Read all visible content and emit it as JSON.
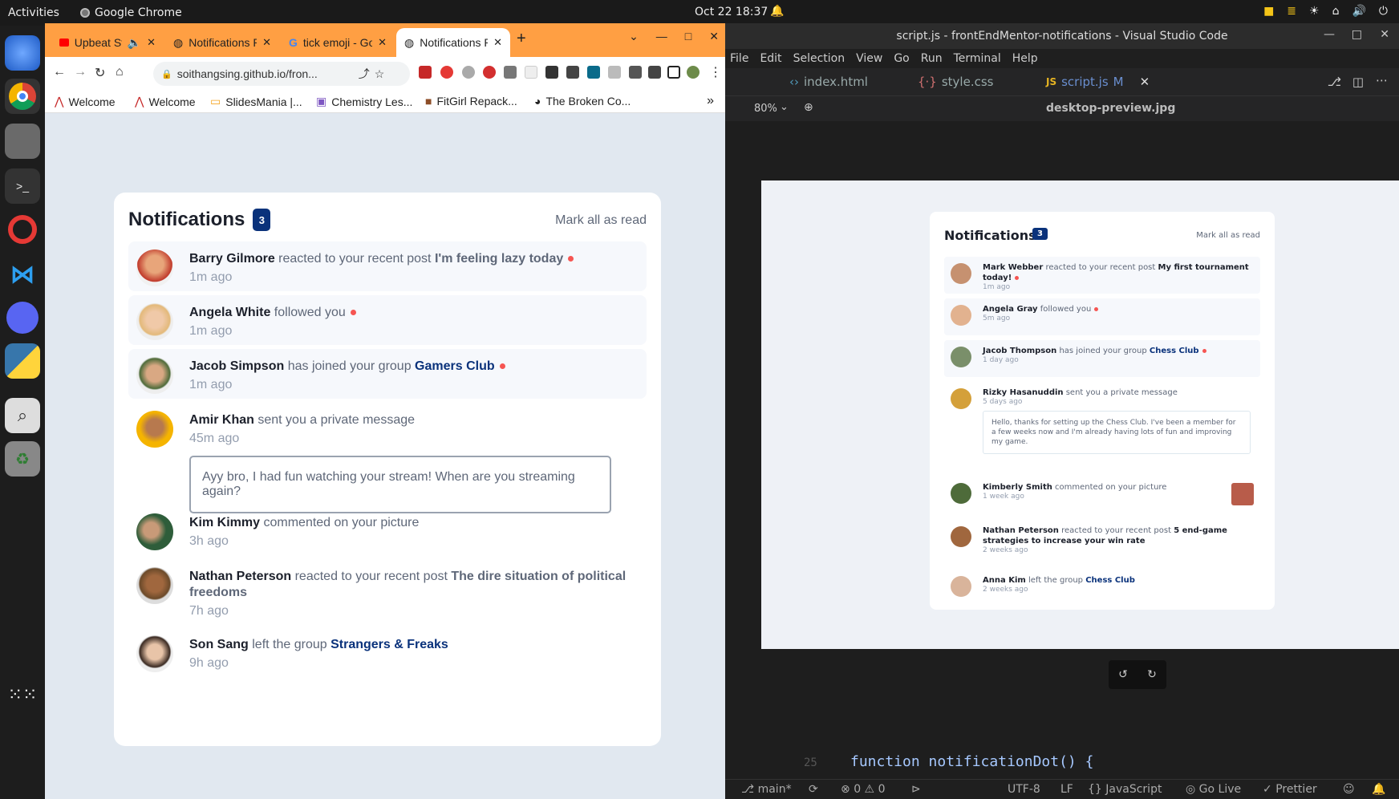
{
  "topbar": {
    "activities": "Activities",
    "app_name": "Google Chrome",
    "clock": "Oct 22  18:37"
  },
  "chrome": {
    "tabs": [
      {
        "title": "Upbeat Stud",
        "icon": "youtube-icon"
      },
      {
        "title": "Notifications Pa",
        "icon": "globe-icon"
      },
      {
        "title": "tick emoji - Goo",
        "icon": "google-icon"
      },
      {
        "title": "Notifications Pa",
        "icon": "globe-icon"
      }
    ],
    "url": "soithangsing.github.io/fron...",
    "bookmarks": [
      "Welcome",
      "Welcome",
      "SlidesMania |...",
      "Chemistry Les...",
      "FitGirl Repack...",
      "The Broken Co..."
    ],
    "bookmarks_more": "»"
  },
  "app": {
    "title": "Notifications",
    "count": "3",
    "mark_all": "Mark all as read",
    "notifications": [
      {
        "name": "Barry Gilmore",
        "action": "reacted to your recent post",
        "target": "I'm feeling lazy today",
        "time": "1m ago"
      },
      {
        "name": "Angela White",
        "action": "followed you",
        "time": "1m ago"
      },
      {
        "name": "Jacob Simpson",
        "action": "has joined your group",
        "target": "Gamers Club",
        "time": "1m ago"
      },
      {
        "name": "Amir Khan",
        "action": "sent you a private message",
        "time": "45m ago",
        "message": "Ayy bro, I had fun watching your stream! When are you streaming again?"
      },
      {
        "name": "Kim Kimmy",
        "action": "commented on your picture",
        "time": "3h ago"
      },
      {
        "name": "Nathan Peterson",
        "action": "reacted to your recent post",
        "target": "The dire situation of political freedoms",
        "time": "7h ago"
      },
      {
        "name": "Son Sang",
        "action": "left the group",
        "target": "Strangers & Freaks",
        "time": "9h ago"
      }
    ]
  },
  "vscode": {
    "title": "script.js - frontEndMentor-notifications - Visual Studio Code",
    "menu": [
      "File",
      "Edit",
      "Selection",
      "View",
      "Go",
      "Run",
      "Terminal",
      "Help"
    ],
    "tabs": [
      "index.html",
      "style.css",
      "script.js"
    ],
    "tab_modified": "M",
    "zoom": "80%",
    "preview_file": "desktop-preview.jpg",
    "code_line_no": "25",
    "code": "function notificationDot() {",
    "status": {
      "branch": "main*",
      "errors": "0",
      "warnings": "0",
      "encoding": "UTF-8",
      "eol": "LF",
      "language": "JavaScript",
      "golive": "Go Live",
      "prettier": "Prettier"
    }
  },
  "preview": {
    "title": "Notifications",
    "count": "3",
    "mark_all": "Mark all as read",
    "items": [
      {
        "name": "Mark Webber",
        "action": "reacted to your recent post",
        "target": "My first tournament today!",
        "time": "1m ago"
      },
      {
        "name": "Angela Gray",
        "action": "followed you",
        "time": "5m ago"
      },
      {
        "name": "Jacob Thompson",
        "action": "has joined your group",
        "target": "Chess Club",
        "time": "1 day ago"
      },
      {
        "name": "Rizky Hasanuddin",
        "action": "sent you a private message",
        "time": "5 days ago",
        "message": "Hello, thanks for setting up the Chess Club. I've been a member for a few weeks now and I'm already having lots of fun and improving my game."
      },
      {
        "name": "Kimberly Smith",
        "action": "commented on your picture",
        "time": "1 week ago"
      },
      {
        "name": "Nathan Peterson",
        "action": "reacted to your recent post",
        "target": "5 end-game strategies to increase your win rate",
        "time": "2 weeks ago"
      },
      {
        "name": "Anna Kim",
        "action": "left the group",
        "target": "Chess Club",
        "time": "2 weeks ago"
      }
    ]
  },
  "colors": {
    "tabstrip": "#ff9f43",
    "badge": "#0a327b",
    "dot": "#f65552"
  }
}
